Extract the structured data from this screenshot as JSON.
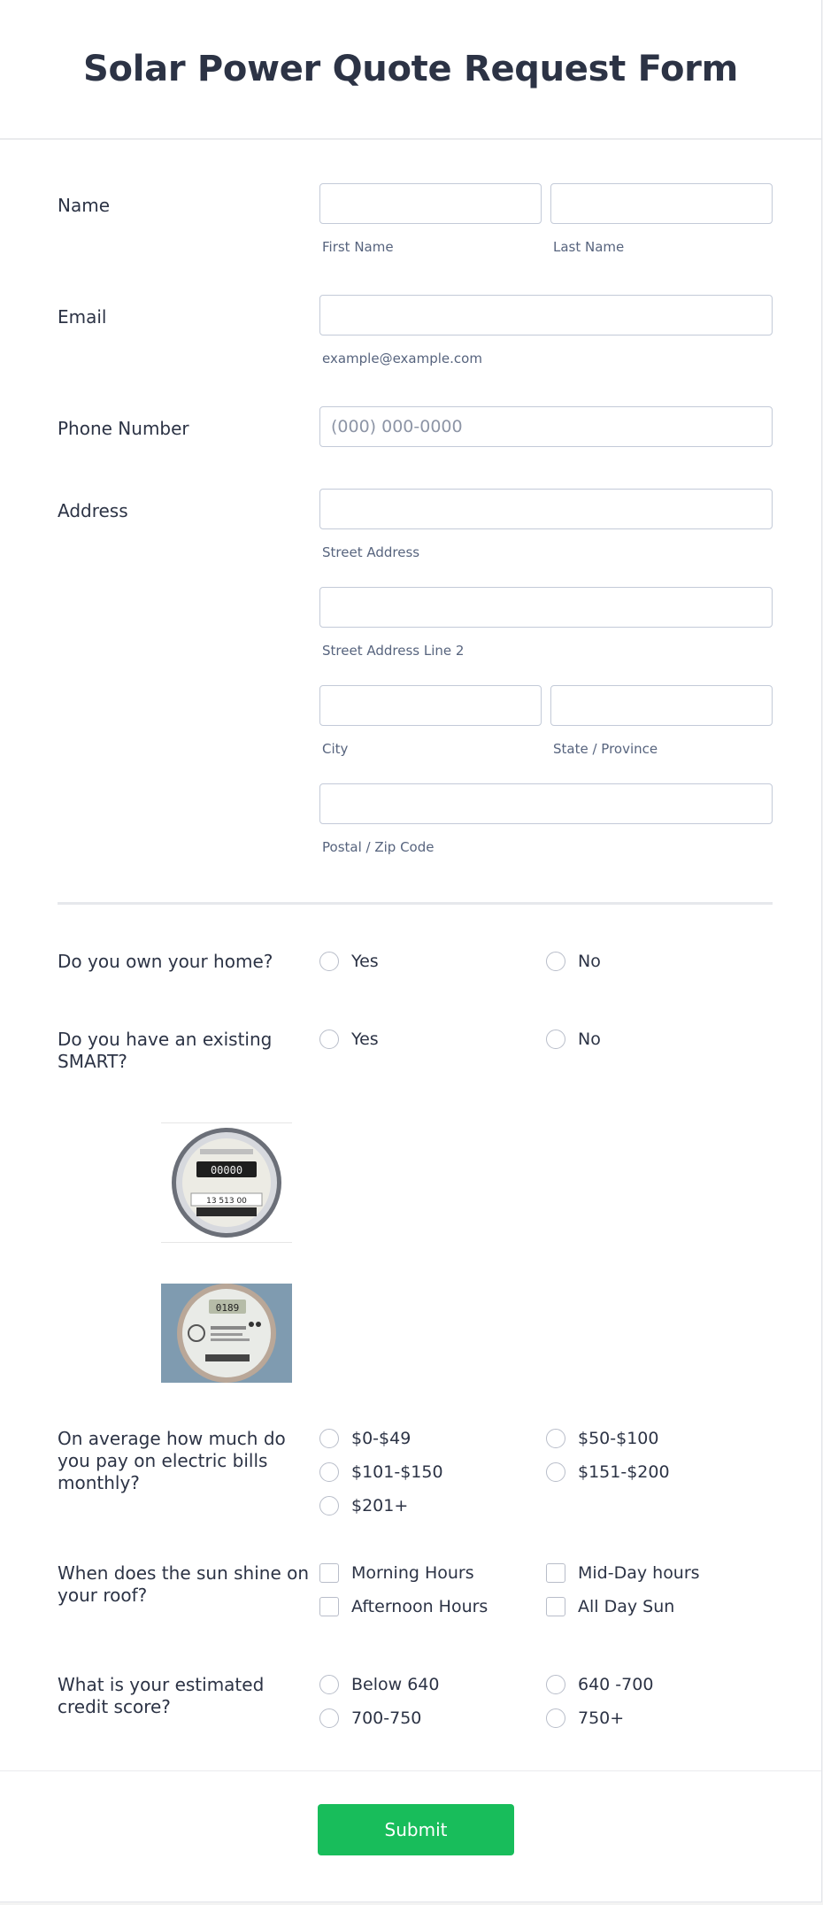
{
  "form": {
    "title": "Solar Power Quote Request Form",
    "name": {
      "label": "Name",
      "first": "First Name",
      "last": "Last Name"
    },
    "email": {
      "label": "Email",
      "sublabel": "example@example.com"
    },
    "phone": {
      "label": "Phone Number",
      "placeholder": "(000) 000-0000"
    },
    "address": {
      "label": "Address",
      "street1": "Street Address",
      "street2": "Street Address Line 2",
      "city": "City",
      "state": "State / Province",
      "zip": "Postal / Zip Code"
    },
    "own_home": {
      "label": "Do you own your home?",
      "options": [
        "Yes",
        "No"
      ]
    },
    "smart": {
      "label": "Do you have an existing SMART?",
      "options": [
        "Yes",
        "No"
      ]
    },
    "bills": {
      "label": "On average how much do you pay on electric bills monthly?",
      "options": [
        "$0-$49",
        "$50-$100",
        "$101-$150",
        "$151-$200",
        "$201+"
      ]
    },
    "sun": {
      "label": "When does the sun shine on your roof?",
      "options": [
        "Morning Hours",
        "Mid-Day hours",
        "Afternoon Hours",
        "All Day Sun"
      ]
    },
    "credit": {
      "label": "What is your estimated credit score?",
      "options": [
        "Below 640",
        "640 -700",
        "700-750",
        "750+"
      ]
    },
    "submit": "Submit"
  },
  "meter_readout_1": "00000",
  "meter_serial_1": "13 513 00",
  "meter_readout_2": "0189"
}
